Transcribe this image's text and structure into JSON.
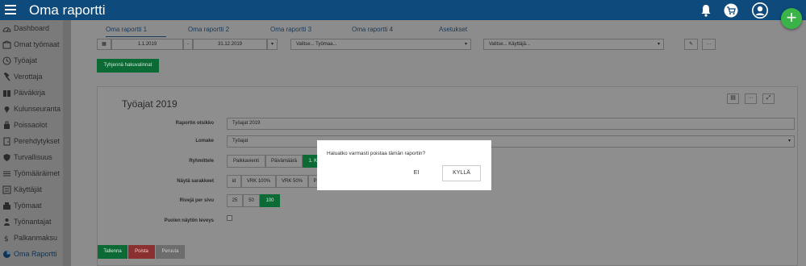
{
  "app": {
    "title": "Oma raportti"
  },
  "sidebar": {
    "items": [
      {
        "label": "Dashboard",
        "icon": "dashboard-icon"
      },
      {
        "label": "Omat työmaat",
        "icon": "site-icon"
      },
      {
        "label": "Työajat",
        "icon": "clock-icon"
      },
      {
        "label": "Verottaja",
        "icon": "hammer-icon"
      },
      {
        "label": "Päiväkirja",
        "icon": "book-icon"
      },
      {
        "label": "Kulunseuranta",
        "icon": "pin-icon"
      },
      {
        "label": "Poissaolot",
        "icon": "luggage-icon"
      },
      {
        "label": "Perehdytykset",
        "icon": "door-icon"
      },
      {
        "label": "Turvallisuus",
        "icon": "shield-icon"
      },
      {
        "label": "Työmääräimet",
        "icon": "list-icon"
      },
      {
        "label": "Käyttäjät",
        "icon": "users-icon"
      },
      {
        "label": "Työmaat",
        "icon": "building-icon"
      },
      {
        "label": "Työnantajat",
        "icon": "person-icon"
      },
      {
        "label": "Palkanmaksu",
        "icon": "money-icon"
      },
      {
        "label": "Oma Raportti",
        "icon": "report-icon"
      }
    ]
  },
  "tabs": [
    "Oma raportti 1",
    "Oma raportti 2",
    "Oma raportti 3",
    "Oma raportti 4",
    "Asetukset"
  ],
  "filters": {
    "date_from": "1.1.2019",
    "date_sep": "-",
    "date_to": "31.12.2019",
    "worksite_placeholder": "Valitse... Työmaa...",
    "user_placeholder": "Valitse... Käyttäjä...",
    "clear_label": "Tyhjennä hakuvalinnat"
  },
  "report": {
    "title": "Työajat 2019",
    "labels": {
      "name": "Raportin otsikko",
      "form": "Lomake",
      "group": "Ryhmittele",
      "columns": "Näytä sarakkeet",
      "rows": "Rivejä per sivu",
      "half": "Puolen näytön leveys"
    },
    "name_value": "Työajat 2019",
    "form_value": "Työajat",
    "group_options": [
      "Palkkavienti",
      "Päivämäärä",
      "1. Käyttäj"
    ],
    "column_options": [
      "id",
      "VRK 100%",
      "VRK 50%",
      "Päivä"
    ],
    "rows_options": [
      "25",
      "50",
      "100"
    ],
    "buttons": {
      "save": "Tallenna",
      "delete": "Poista",
      "cancel": "Peruuta"
    }
  },
  "modal": {
    "question": "Haluatko varmasti poistaa tämän raportin?",
    "no": "EI",
    "yes": "KYLLÄ"
  },
  "colors": {
    "topbar": "#0f4a7c",
    "green": "#0c6a35",
    "fab": "#3ab349",
    "delete": "#b11f1f"
  }
}
